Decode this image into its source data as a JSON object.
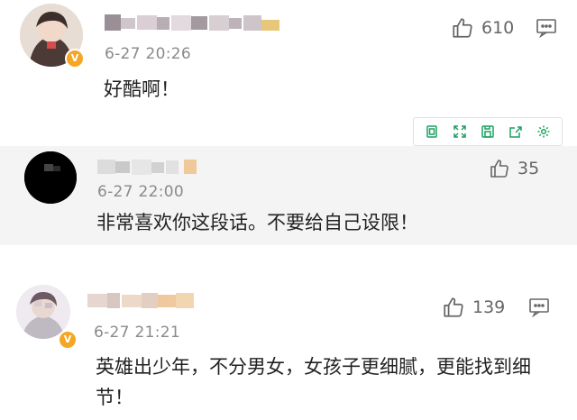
{
  "comments": [
    {
      "time": "6-27 20:26",
      "text": "好酷啊！",
      "likes": "610",
      "verified_badge": "V",
      "reply_icon": "comment-icon"
    },
    {
      "time": "6-27 22:00",
      "text": "非常喜欢你这段话。不要给自己设限！",
      "likes": "35"
    },
    {
      "time": "6-27 21:21",
      "text": "英雄出少年，不分男女，女孩子更细腻，更能找到细节！",
      "likes": "139",
      "verified_badge": "V",
      "reply_icon": "comment-icon"
    }
  ],
  "toolbar_icons": [
    "copy-icon",
    "expand-icon",
    "save-icon",
    "share-icon",
    "settings-icon"
  ],
  "colors": {
    "accent_green": "#1aa260",
    "like_gray": "#666666",
    "verified_gold": "#f5a623",
    "band_gray": "#f4f4f4"
  }
}
